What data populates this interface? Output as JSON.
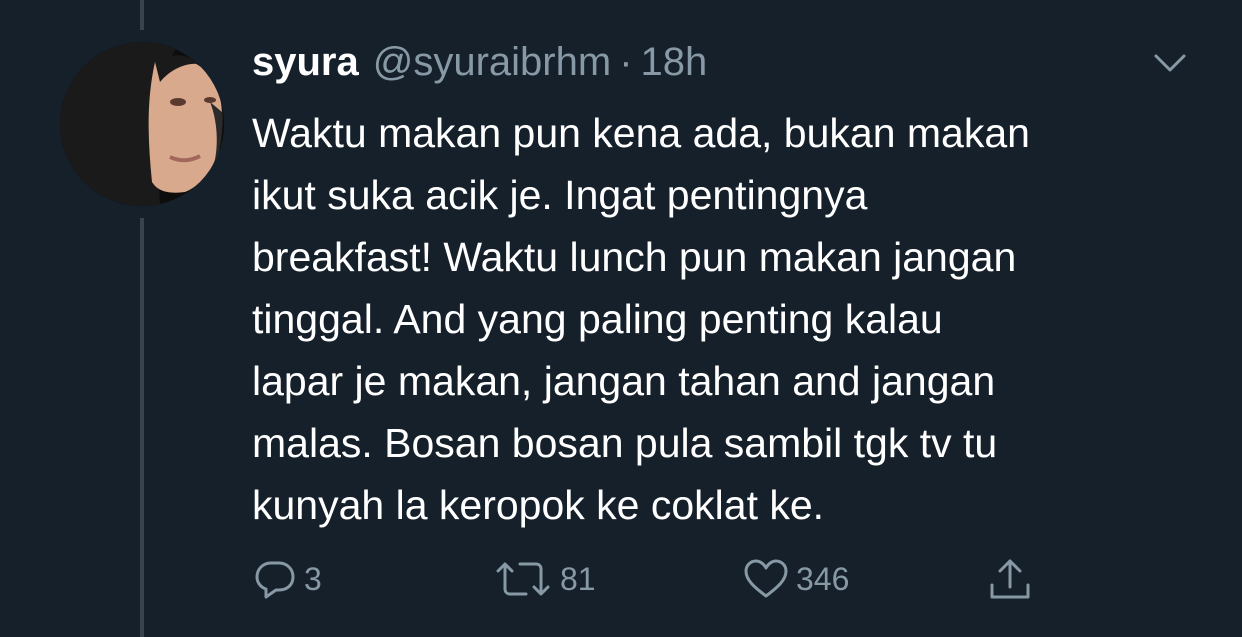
{
  "tweet": {
    "display_name": "syura",
    "handle": "@syuraibrhm",
    "separator": "·",
    "time": "18h",
    "text": "Waktu makan pun kena ada, bukan makan\nikut suka acik je. Ingat pentingnya\nbreakfast! Waktu lunch pun makan jangan\ntinggal. And yang paling penting kalau\nlapar je makan, jangan tahan and jangan\nmalas. Bosan bosan pula sambil tgk tv tu\nkunyah la keropok ke coklat ke."
  },
  "actions": {
    "reply_count": "3",
    "retweet_count": "81",
    "like_count": "346"
  },
  "icons": {
    "reply": "reply-icon",
    "retweet": "retweet-icon",
    "like": "heart-icon",
    "share": "share-icon",
    "caret": "chevron-down-icon"
  },
  "colors": {
    "background": "#15202b",
    "text": "#ffffff",
    "secondary": "#8899a6",
    "thread_line": "#38444d"
  }
}
